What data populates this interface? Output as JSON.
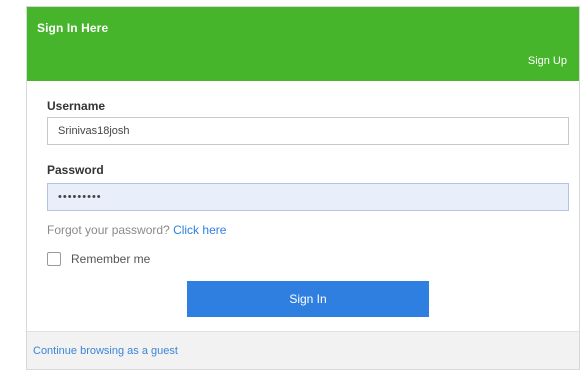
{
  "header": {
    "title": "Sign In Here",
    "signup_label": "Sign Up"
  },
  "form": {
    "username_label": "Username",
    "username_value": "Srinivas18josh",
    "password_label": "Password",
    "password_value": "•••••••••",
    "forgot_text": "Forgot your password? ",
    "forgot_link": "Click here",
    "remember_label": "Remember me",
    "signin_label": "Sign In"
  },
  "footer": {
    "guest_link": "Continue browsing as a guest"
  },
  "colors": {
    "header_bg": "#47b52c",
    "button_bg": "#2f7fe0",
    "link": "#2f7fe0"
  }
}
